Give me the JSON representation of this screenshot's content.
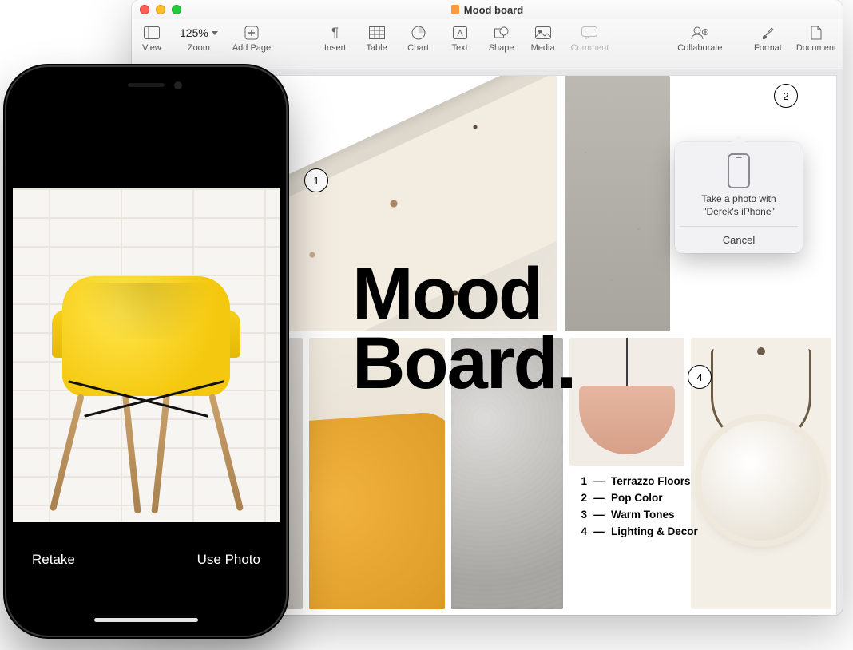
{
  "window": {
    "title": "Mood board",
    "traffic_lights": {
      "close": "#ff5f56",
      "min": "#ffbd2e",
      "max": "#27c93f"
    }
  },
  "toolbar": {
    "view": {
      "label": "View"
    },
    "zoom": {
      "value": "125%",
      "label": "Zoom"
    },
    "add_page": {
      "label": "Add Page"
    },
    "insert": {
      "label": "Insert"
    },
    "table": {
      "label": "Table"
    },
    "chart": {
      "label": "Chart"
    },
    "text": {
      "label": "Text"
    },
    "shape": {
      "label": "Shape"
    },
    "media": {
      "label": "Media"
    },
    "comment": {
      "label": "Comment"
    },
    "collaborate": {
      "label": "Collaborate"
    },
    "format": {
      "label": "Format"
    },
    "document": {
      "label": "Document"
    }
  },
  "document": {
    "headline_line1": "Mood",
    "headline_line2": "Board.",
    "callouts": {
      "one": "1",
      "two": "2",
      "four": "4"
    },
    "legend": [
      {
        "num": "1",
        "label": "Terrazzo Floors"
      },
      {
        "num": "2",
        "label": "Pop Color"
      },
      {
        "num": "3",
        "label": "Warm Tones"
      },
      {
        "num": "4",
        "label": "Lighting & Decor"
      }
    ]
  },
  "popover": {
    "message_line1": "Take a photo with",
    "message_line2": "\"Derek's iPhone\"",
    "cancel": "Cancel"
  },
  "iphone": {
    "retake": "Retake",
    "use_photo": "Use Photo"
  }
}
